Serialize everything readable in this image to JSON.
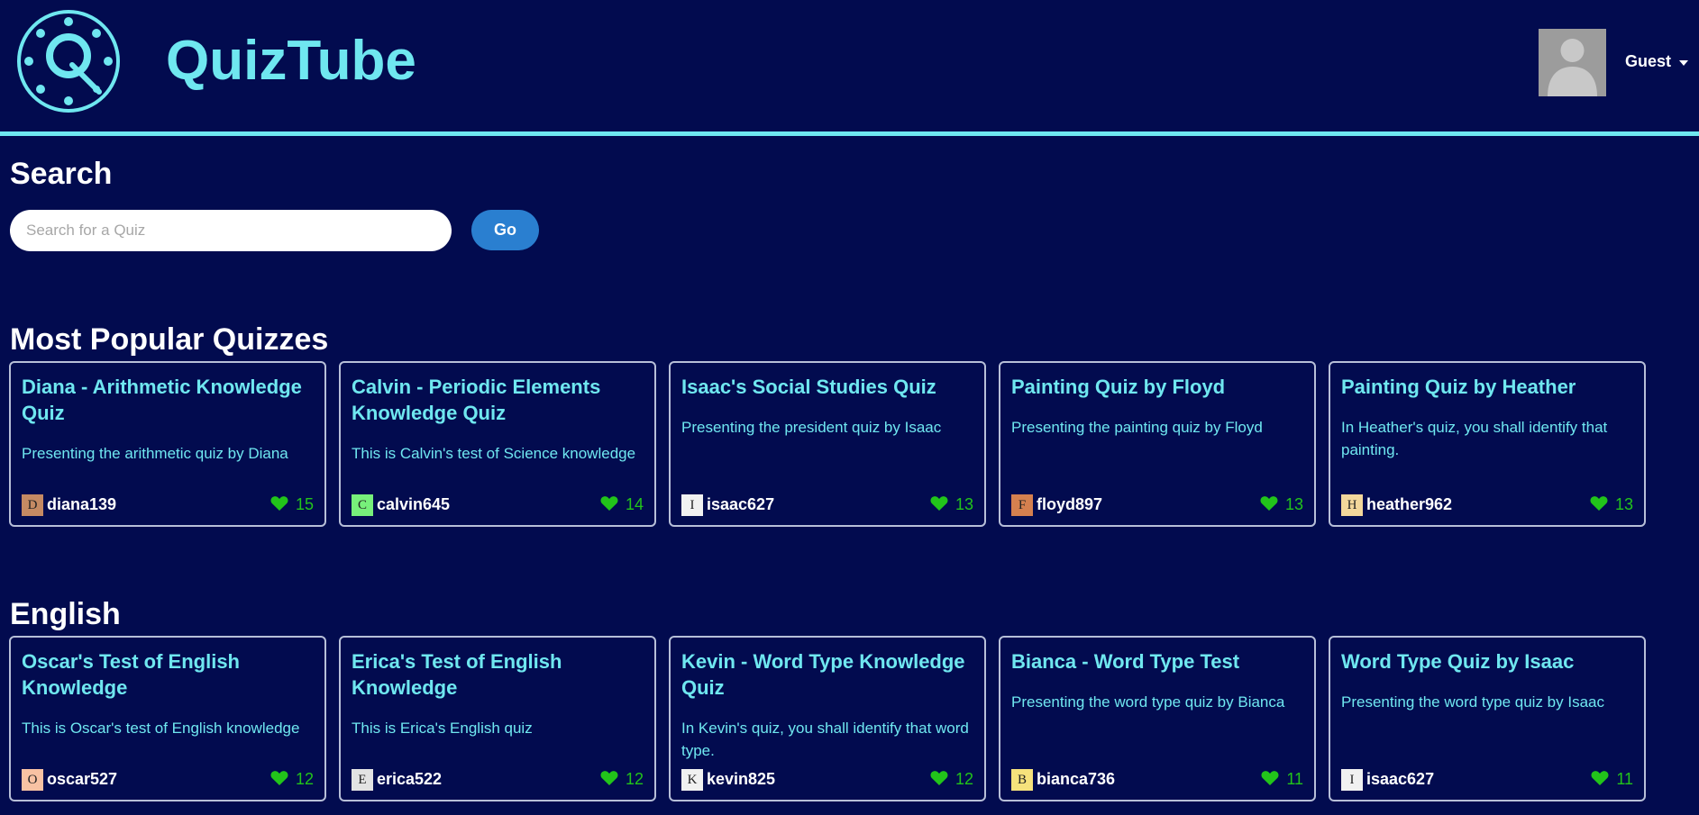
{
  "header": {
    "brand": "QuizTube",
    "user_label": "Guest"
  },
  "search": {
    "title": "Search",
    "placeholder": "Search for a Quiz",
    "button_label": "Go"
  },
  "sections": [
    {
      "title": "Most Popular Quizzes",
      "cards": [
        {
          "title": "Diana - Arithmetic Knowledge Quiz",
          "desc": "Presenting the arithmetic quiz by Diana",
          "author": "diana139",
          "initial": "D",
          "avatar_color": "#c58a63",
          "likes": "15"
        },
        {
          "title": "Calvin - Periodic Elements Knowledge Quiz",
          "desc": "This is Calvin's test of Science knowledge",
          "author": "calvin645",
          "initial": "C",
          "avatar_color": "#77f07a",
          "likes": "14"
        },
        {
          "title": "Isaac's Social Studies Quiz",
          "desc": "Presenting the president quiz by Isaac",
          "author": "isaac627",
          "initial": "I",
          "avatar_color": "#f1f1f1",
          "likes": "13"
        },
        {
          "title": "Painting Quiz by Floyd",
          "desc": "Presenting the painting quiz by Floyd",
          "author": "floyd897",
          "initial": "F",
          "avatar_color": "#d5804f",
          "likes": "13"
        },
        {
          "title": "Painting Quiz by Heather",
          "desc": "In Heather's quiz, you shall identify that painting.",
          "author": "heather962",
          "initial": "H",
          "avatar_color": "#f3d79b",
          "likes": "13"
        }
      ]
    },
    {
      "title": "English",
      "cards": [
        {
          "title": "Oscar's Test of English Knowledge",
          "desc": "This is Oscar's test of English knowledge",
          "author": "oscar527",
          "initial": "O",
          "avatar_color": "#f8c2a3",
          "likes": "12"
        },
        {
          "title": "Erica's Test of English Knowledge",
          "desc": "This is Erica's English quiz",
          "author": "erica522",
          "initial": "E",
          "avatar_color": "#e3e3e3",
          "likes": "12"
        },
        {
          "title": "Kevin - Word Type Knowledge Quiz",
          "desc": "In Kevin's quiz, you shall identify that word type.",
          "author": "kevin825",
          "initial": "K",
          "avatar_color": "#f1f1f1",
          "likes": "12"
        },
        {
          "title": "Bianca - Word Type Test",
          "desc": "Presenting the word type quiz by Bianca",
          "author": "bianca736",
          "initial": "B",
          "avatar_color": "#f6e27c",
          "likes": "11"
        },
        {
          "title": "Word Type Quiz by Isaac",
          "desc": "Presenting the word type quiz by Isaac",
          "author": "isaac627",
          "initial": "I",
          "avatar_color": "#f1f1f1",
          "likes": "11"
        }
      ]
    }
  ],
  "colors": {
    "background": "#020b4f",
    "accent": "#6fe7f0",
    "button": "#2a7fd0",
    "like": "#22c41a"
  }
}
